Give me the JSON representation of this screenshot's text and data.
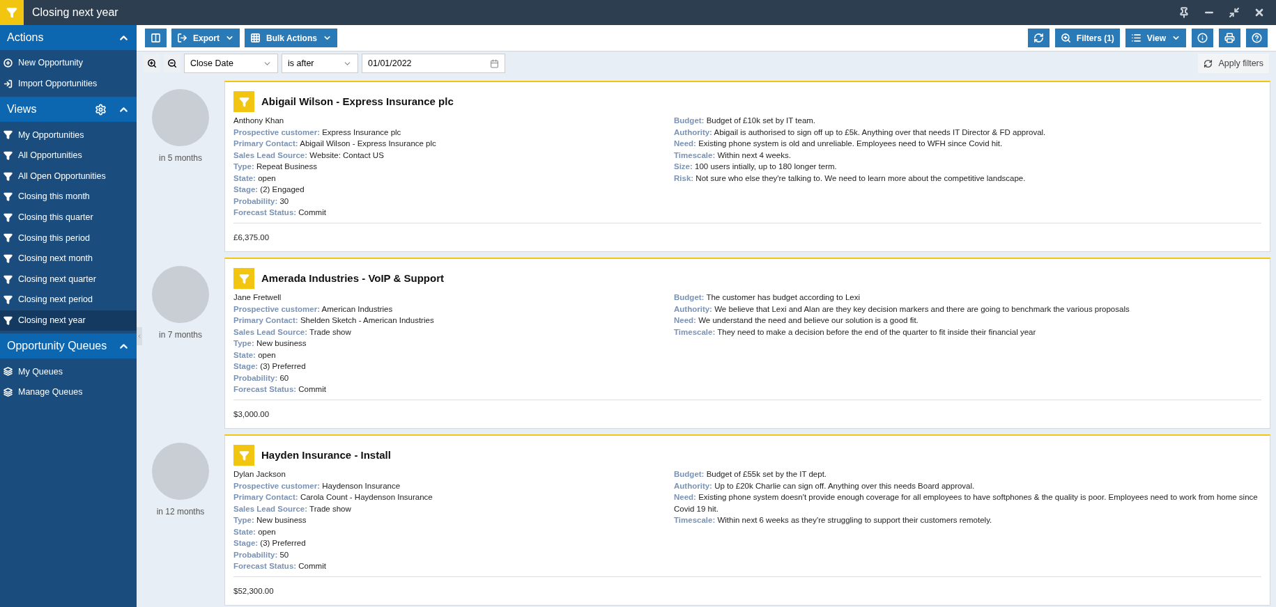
{
  "title_bar": {
    "title": "Closing next year"
  },
  "sidebar": {
    "sections": [
      {
        "title": "Actions",
        "expanded": true,
        "settings": false,
        "items": [
          {
            "label": "New Opportunity",
            "kind": "add",
            "selected": false
          },
          {
            "label": "Import Opportunities",
            "kind": "import",
            "selected": false
          }
        ]
      },
      {
        "title": "Views",
        "expanded": true,
        "settings": true,
        "items": [
          {
            "label": "My Opportunities",
            "kind": "filter",
            "selected": false
          },
          {
            "label": "All Opportunities",
            "kind": "filter",
            "selected": false
          },
          {
            "label": "All Open Opportunities",
            "kind": "filter",
            "selected": false
          },
          {
            "label": "Closing this month",
            "kind": "filter",
            "selected": false
          },
          {
            "label": "Closing this quarter",
            "kind": "filter",
            "selected": false
          },
          {
            "label": "Closing this period",
            "kind": "filter",
            "selected": false
          },
          {
            "label": "Closing next month",
            "kind": "filter",
            "selected": false
          },
          {
            "label": "Closing next quarter",
            "kind": "filter",
            "selected": false
          },
          {
            "label": "Closing next period",
            "kind": "filter",
            "selected": false
          },
          {
            "label": "Closing next year",
            "kind": "filter",
            "selected": true
          }
        ]
      },
      {
        "title": "Opportunity Queues",
        "expanded": true,
        "settings": false,
        "items": [
          {
            "label": "My Queues",
            "kind": "queue",
            "selected": false
          },
          {
            "label": "Manage Queues",
            "kind": "queue",
            "selected": false
          }
        ]
      }
    ]
  },
  "toolbar": {
    "left": [
      {
        "kind": "panel",
        "dropdown": false
      },
      {
        "kind": "export",
        "label": "Export",
        "dropdown": true
      },
      {
        "kind": "bulk",
        "label": "Bulk Actions",
        "dropdown": true
      }
    ],
    "right": [
      {
        "kind": "refresh",
        "dropdown": false
      },
      {
        "kind": "filters",
        "label": "Filters (1)",
        "dropdown": false
      },
      {
        "kind": "view",
        "label": "View",
        "dropdown": true
      },
      {
        "kind": "info",
        "dropdown": false
      },
      {
        "kind": "print",
        "dropdown": false
      },
      {
        "kind": "help",
        "dropdown": false
      }
    ]
  },
  "filter_bar": {
    "field": "Close Date",
    "operator": "is after",
    "date": "01/01/2022",
    "apply": "Apply filters"
  },
  "opportunities": [
    {
      "title": "Abigail Wilson - Express Insurance plc",
      "owner": "Anthony Khan",
      "due": "in 5 months",
      "amount": "£6,375.00",
      "details": [
        {
          "label": "Prospective customer:",
          "value": "Express Insurance plc"
        },
        {
          "label": "Primary Contact:",
          "value": "Abigail Wilson - Express Insurance plc"
        },
        {
          "label": "Sales Lead Source:",
          "value": "Website: Contact US"
        },
        {
          "label": "Type:",
          "value": "Repeat Business"
        },
        {
          "label": "State:",
          "value": "open"
        },
        {
          "label": "Stage:",
          "value": "(2) Engaged"
        },
        {
          "label": "Probability:",
          "value": "30"
        },
        {
          "label": "Forecast Status:",
          "value": "Commit"
        }
      ],
      "notes": [
        {
          "label": "Budget:",
          "value": "Budget of £10k set by IT team."
        },
        {
          "label": "Authority:",
          "value": "Abigail is authorised to sign off up to £5k. Anything over that needs IT Director & FD approval."
        },
        {
          "label": "Need:",
          "value": "Existing phone system is old and unreliable. Employees need to WFH since Covid hit."
        },
        {
          "label": "Timescale:",
          "value": "Within next 4 weeks."
        },
        {
          "label": "Size:",
          "value": "100 users intially, up to 180 longer term."
        },
        {
          "label": "Risk:",
          "value": "Not sure who else they're talking to. We need to learn more about the competitive landscape."
        }
      ]
    },
    {
      "title": "Amerada Industries - VoIP & Support",
      "owner": "Jane Fretwell",
      "due": "in 7 months",
      "amount": "$3,000.00",
      "details": [
        {
          "label": "Prospective customer:",
          "value": "American Industries"
        },
        {
          "label": "Primary Contact:",
          "value": "Shelden Sketch - American Industries"
        },
        {
          "label": "Sales Lead Source:",
          "value": "Trade show"
        },
        {
          "label": "Type:",
          "value": "New business"
        },
        {
          "label": "State:",
          "value": "open"
        },
        {
          "label": "Stage:",
          "value": "(3) Preferred"
        },
        {
          "label": "Probability:",
          "value": "60"
        },
        {
          "label": "Forecast Status:",
          "value": "Commit"
        }
      ],
      "notes": [
        {
          "label": "Budget:",
          "value": "The customer has budget according to Lexi"
        },
        {
          "label": "Authority:",
          "value": "We believe that Lexi and Alan are they key decision markers and there are going to benchmark the various proposals"
        },
        {
          "label": "Need:",
          "value": "We understand the need and believe our solution is a good fit."
        },
        {
          "label": "Timescale:",
          "value": "They need to make a decision before the end of the quarter to fit inside their financial year"
        }
      ]
    },
    {
      "title": "Hayden Insurance - Install",
      "owner": "Dylan Jackson",
      "due": "in 12 months",
      "amount": "$52,300.00",
      "details": [
        {
          "label": "Prospective customer:",
          "value": "Haydenson Insurance"
        },
        {
          "label": "Primary Contact:",
          "value": "Carola Count - Haydenson Insurance"
        },
        {
          "label": "Sales Lead Source:",
          "value": "Trade show"
        },
        {
          "label": "Type:",
          "value": "New business"
        },
        {
          "label": "State:",
          "value": "open"
        },
        {
          "label": "Stage:",
          "value": "(3) Preferred"
        },
        {
          "label": "Probability:",
          "value": "50"
        },
        {
          "label": "Forecast Status:",
          "value": "Commit"
        }
      ],
      "notes": [
        {
          "label": "Budget:",
          "value": "Budget of £55k set by the IT dept."
        },
        {
          "label": "Authority:",
          "value": "Up to £20k Charlie can sign off. Anything over this needs Board approval."
        },
        {
          "label": "Need:",
          "value": "Existing phone system doesn't provide enough coverage for all employees to have softphones & the quality is poor. Employees need to work from home since Covid 19 hit."
        },
        {
          "label": "Timescale:",
          "value": "Within next 6 weeks as they're struggling to support their customers remotely."
        }
      ]
    }
  ]
}
